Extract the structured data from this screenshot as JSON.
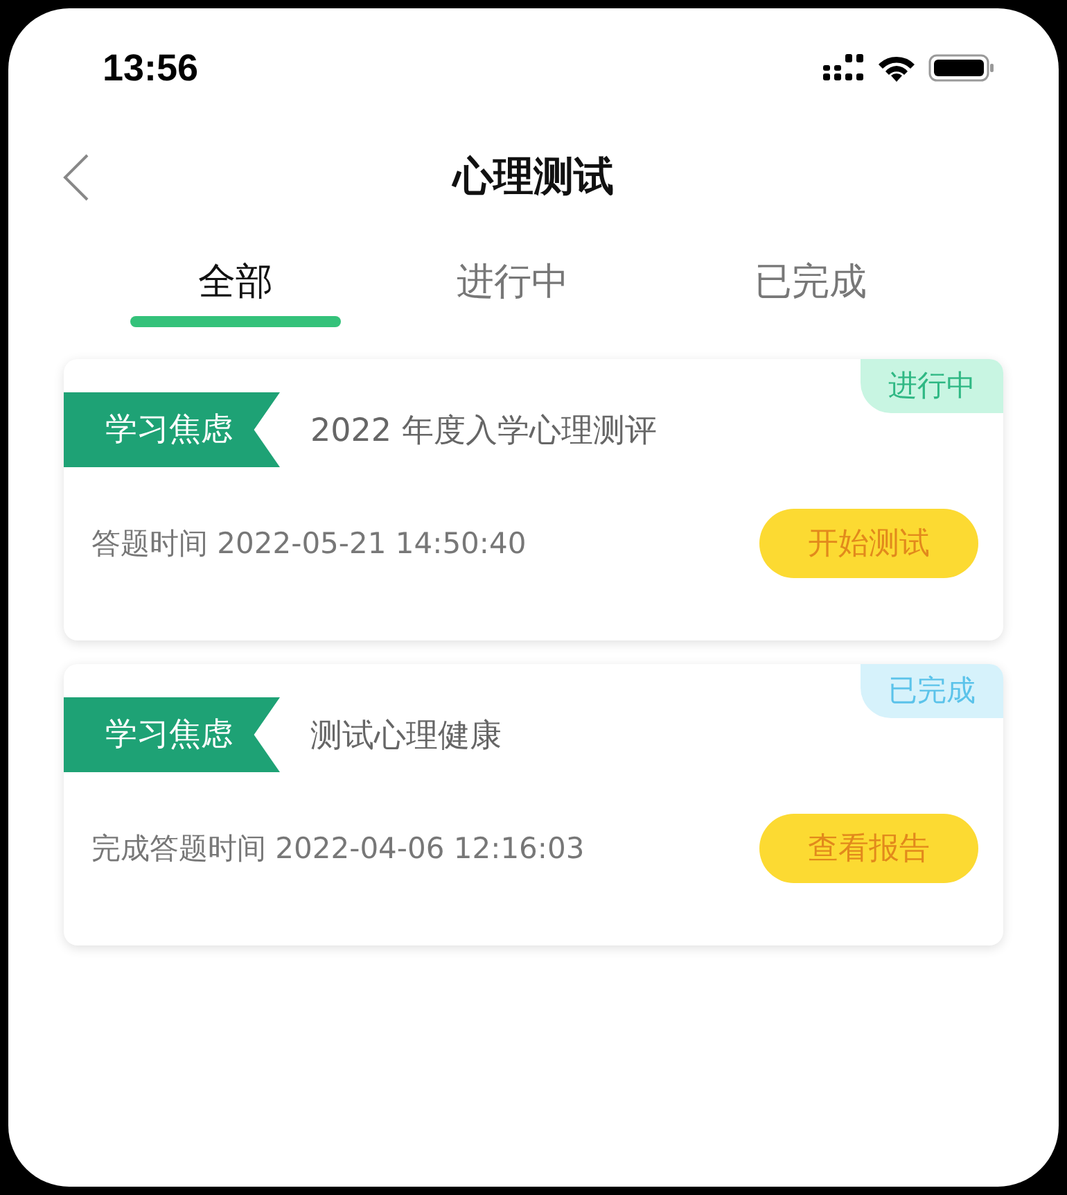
{
  "status_bar": {
    "time": "13:56"
  },
  "nav": {
    "title": "心理测试"
  },
  "tabs": [
    {
      "label": "全部",
      "selected": true
    },
    {
      "label": "进行中",
      "selected": false
    },
    {
      "label": "已完成",
      "selected": false
    }
  ],
  "tests": [
    {
      "category": "学习焦虑",
      "title": "2022 年度入学心理测评",
      "time": "答题时间 2022-05-21 14:50:40",
      "status": {
        "label": "进行中",
        "kind": "in_progress"
      },
      "action": "开始测试"
    },
    {
      "category": "学习焦虑",
      "title": "测试心理健康",
      "time": "完成答题时间 2022-04-06 12:16:03",
      "status": {
        "label": "已完成",
        "kind": "done"
      },
      "action": "查看报告"
    }
  ]
}
